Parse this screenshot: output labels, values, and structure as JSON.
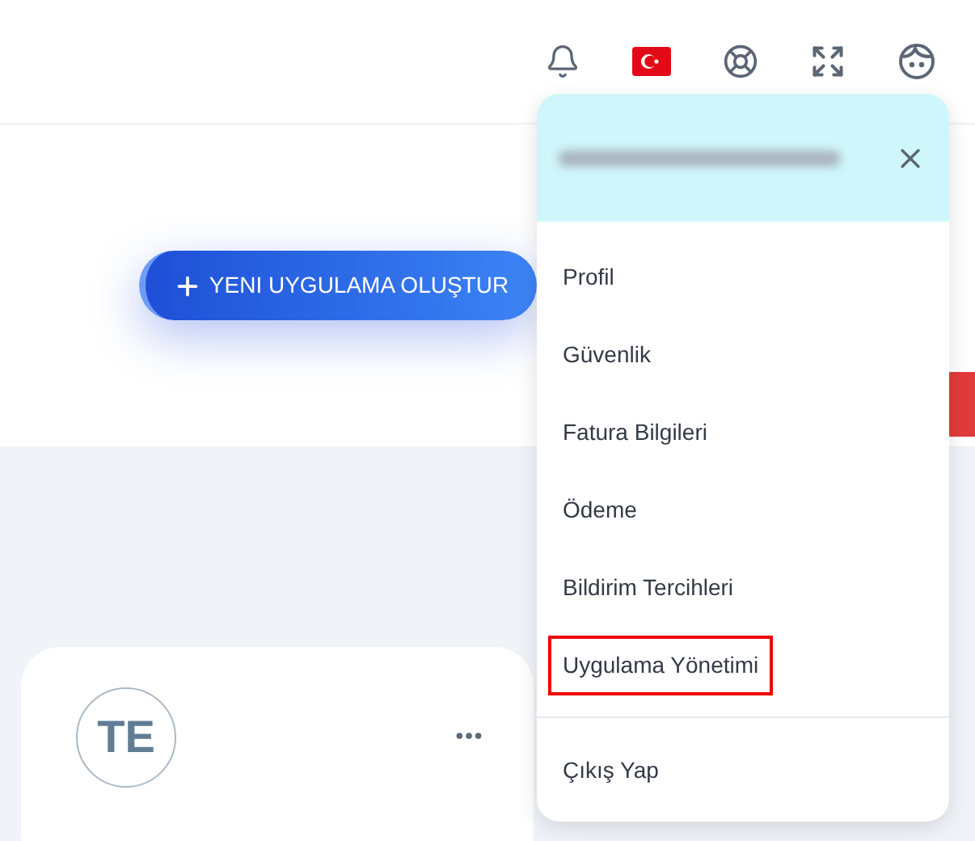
{
  "create_button": {
    "label": "YENI UYGULAMA OLUŞTUR"
  },
  "app_card": {
    "initials": "TE"
  },
  "user_menu": {
    "items": [
      {
        "label": "Profil",
        "highlighted": false
      },
      {
        "label": "Güvenlik",
        "highlighted": false
      },
      {
        "label": "Fatura Bilgileri",
        "highlighted": false
      },
      {
        "label": "Ödeme",
        "highlighted": false
      },
      {
        "label": "Bildirim Tercihleri",
        "highlighted": false
      },
      {
        "label": "Uygulama Yönetimi",
        "highlighted": true
      }
    ],
    "logout": {
      "label": "Çıkış Yap"
    }
  }
}
